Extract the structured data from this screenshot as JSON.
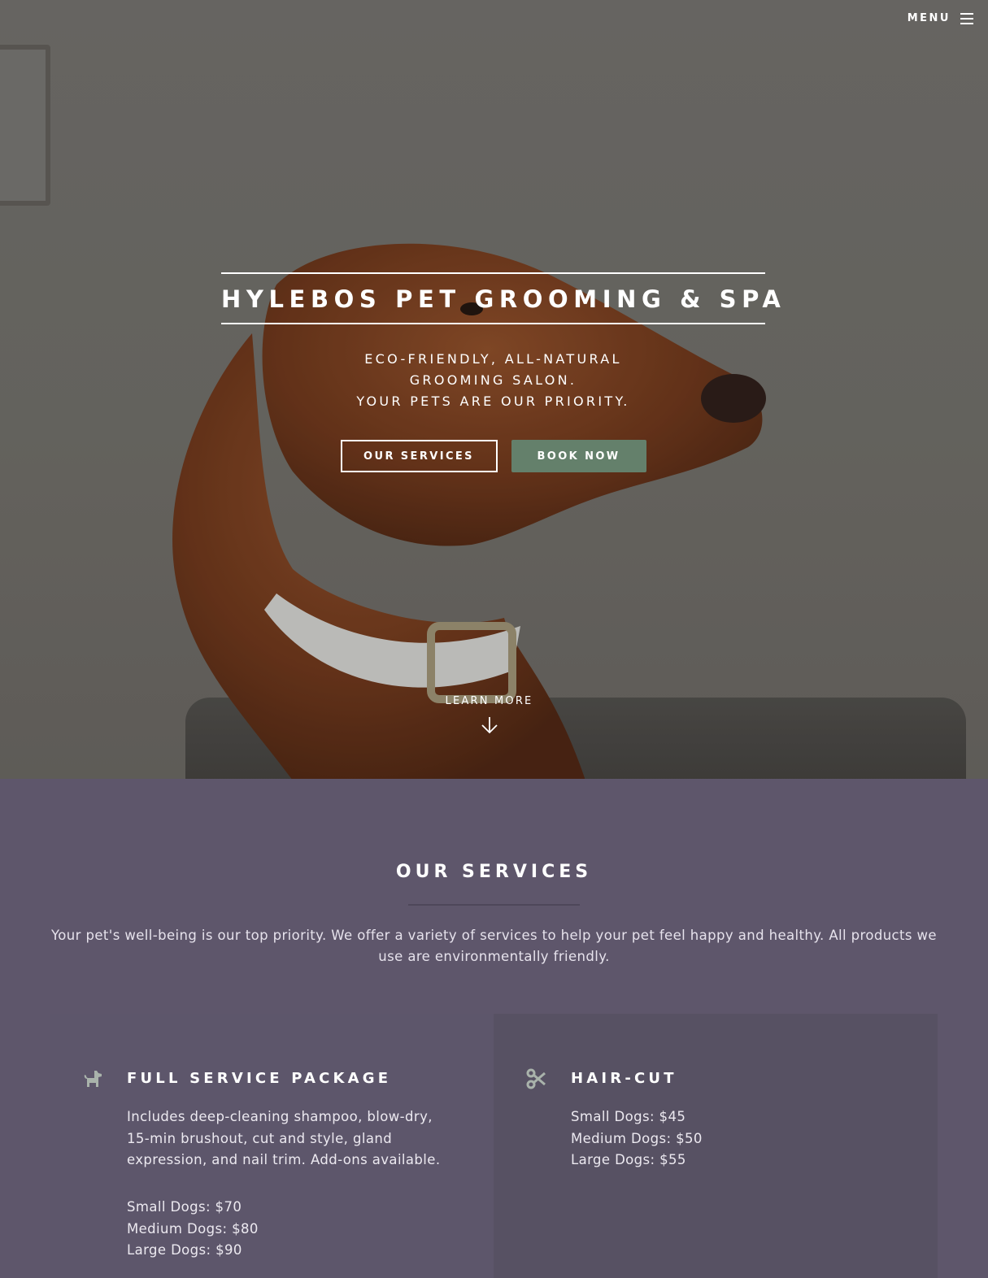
{
  "nav": {
    "menu_label": "MENU"
  },
  "hero": {
    "title": "HYLEBOS PET GROOMING & SPA",
    "tagline_lines": [
      "ECO-FRIENDLY, ALL-NATURAL",
      "GROOMING SALON.",
      "YOUR PETS ARE OUR PRIORITY."
    ],
    "services_button": "OUR SERVICES",
    "book_button": "BOOK NOW",
    "learn_more": "LEARN MORE"
  },
  "services": {
    "title": "OUR SERVICES",
    "intro": "Your pet's well-being is our top priority. We offer a variety of services to help your pet feel happy and healthy. All products we use are environmentally friendly.",
    "cards": [
      {
        "icon": "dog-icon",
        "title": "FULL SERVICE PACKAGE",
        "description": "Includes deep-cleaning shampoo, blow-dry, 15-min brushout, cut and style, gland expression, and nail trim. Add-ons available.",
        "prices": [
          "Small Dogs: $70",
          "Medium Dogs: $80",
          "Large Dogs: $90"
        ]
      },
      {
        "icon": "scissors-icon",
        "title": "HAIR-CUT",
        "prices": [
          "Small Dogs: $45",
          "Medium Dogs: $50",
          "Large Dogs: $55"
        ]
      }
    ]
  },
  "colors": {
    "accent_green": "#64806b",
    "section_bg": "#5e566b",
    "card_alt_bg": "#575163",
    "icon_tint": "#a9b3ab"
  }
}
